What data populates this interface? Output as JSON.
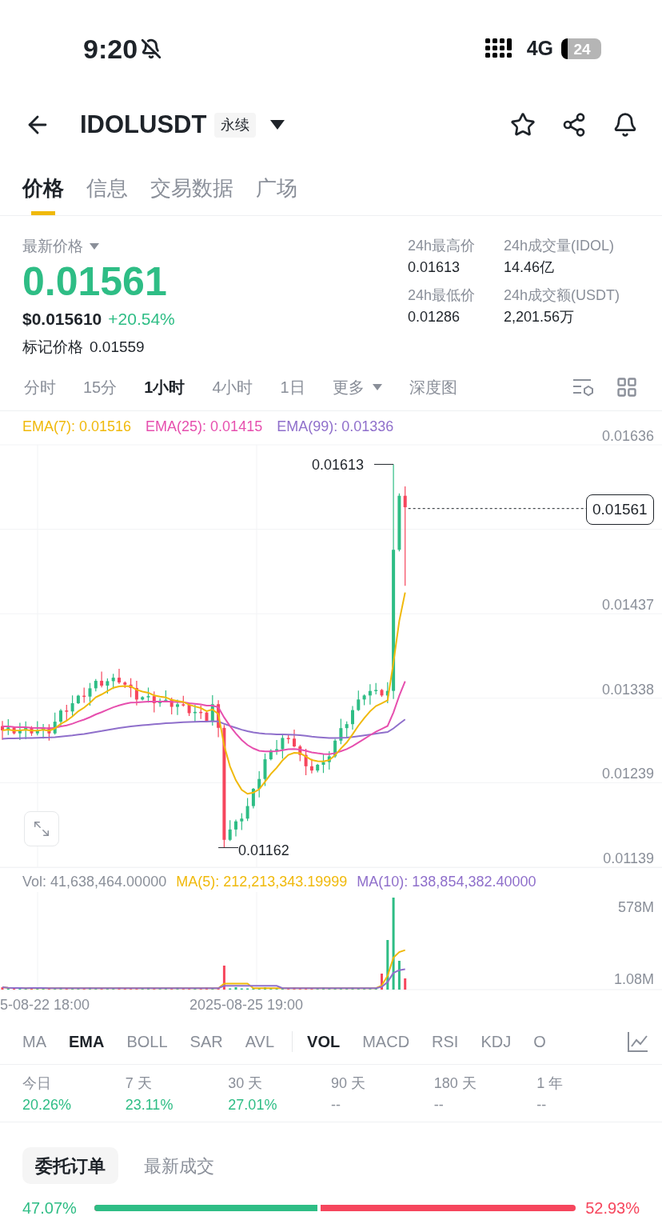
{
  "status_bar": {
    "time": "9:20",
    "network": "4G",
    "battery": "24"
  },
  "header": {
    "symbol": "IDOLUSDT",
    "tag": "永续"
  },
  "tabs": [
    {
      "label": "价格",
      "selected": true
    },
    {
      "label": "信息",
      "selected": false
    },
    {
      "label": "交易数据",
      "selected": false
    },
    {
      "label": "广场",
      "selected": false
    }
  ],
  "price": {
    "label": "最新价格",
    "last": "0.01561",
    "usd": "$0.015610",
    "change": "+20.54%",
    "mark_label": "标记价格",
    "mark": "0.01559"
  },
  "stats": [
    {
      "label": "24h最高价",
      "value": "0.01613"
    },
    {
      "label": "24h成交量(IDOL)",
      "value": "14.46亿"
    },
    {
      "label": "24h最低价",
      "value": "0.01286"
    },
    {
      "label": "24h成交额(USDT)",
      "value": "2,201.56万"
    }
  ],
  "timeframes": [
    {
      "label": "分时",
      "selected": false,
      "kind": "tab"
    },
    {
      "label": "15分",
      "selected": false,
      "kind": "tab"
    },
    {
      "label": "1小时",
      "selected": true,
      "kind": "tab"
    },
    {
      "label": "4小时",
      "selected": false,
      "kind": "tab"
    },
    {
      "label": "1日",
      "selected": false,
      "kind": "tab"
    },
    {
      "label": "更多",
      "selected": false,
      "kind": "dropdown"
    },
    {
      "label": "深度图",
      "selected": false,
      "kind": "tab"
    }
  ],
  "chart": {
    "legend": [
      {
        "text": "EMA(7): 0.01516",
        "color": "#f0b90b"
      },
      {
        "text": "EMA(25): 0.01415",
        "color": "#e64fae"
      },
      {
        "text": "EMA(99): 0.01336",
        "color": "#8f6fcb"
      }
    ],
    "y_labels": [
      "0.01636",
      "0.01437",
      "0.01338",
      "0.01239",
      "0.01139"
    ],
    "high": "0.01613",
    "low": "0.01162",
    "current": "0.01561"
  },
  "volume": {
    "legend": [
      {
        "text": "Vol: 41,638,464.00000",
        "color": "#8a8f99"
      },
      {
        "text": "MA(5): 212,213,343.19999",
        "color": "#f0b90b"
      },
      {
        "text": "MA(10): 138,854,382.40000",
        "color": "#8f6fcb"
      }
    ],
    "y_labels": [
      "578M",
      "1.08M"
    ],
    "dates": [
      "5-08-22 18:00",
      "2025-08-25 19:00"
    ]
  },
  "main_indicators": [
    {
      "label": "MA",
      "selected": false
    },
    {
      "label": "EMA",
      "selected": true
    },
    {
      "label": "BOLL",
      "selected": false
    },
    {
      "label": "SAR",
      "selected": false
    },
    {
      "label": "AVL",
      "selected": false
    }
  ],
  "sub_indicators": [
    {
      "label": "VOL",
      "selected": true
    },
    {
      "label": "MACD",
      "selected": false
    },
    {
      "label": "RSI",
      "selected": false
    },
    {
      "label": "KDJ",
      "selected": false
    },
    {
      "label": "O",
      "selected": false
    }
  ],
  "returns": [
    {
      "period": "今日",
      "value": "20.26%",
      "kind": "up"
    },
    {
      "period": "7 天",
      "value": "23.11%",
      "kind": "up"
    },
    {
      "period": "30 天",
      "value": "27.01%",
      "kind": "up"
    },
    {
      "period": "90 天",
      "value": "--",
      "kind": "none"
    },
    {
      "period": "180 天",
      "value": "--",
      "kind": "none"
    },
    {
      "period": "1 年",
      "value": "--",
      "kind": "none"
    }
  ],
  "order_tabs": [
    {
      "label": "委托订单",
      "selected": true
    },
    {
      "label": "最新成交",
      "selected": false
    }
  ],
  "ratio": {
    "buy": "47.07%",
    "sell": "52.93%",
    "level": 0.4707
  }
}
